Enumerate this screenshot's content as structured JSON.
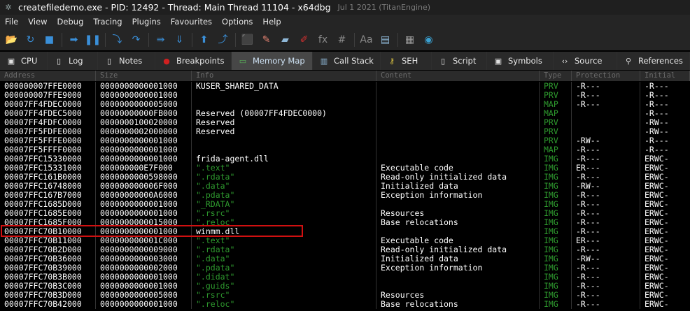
{
  "window": {
    "title": "createfiledemo.exe - PID: 12492 - Thread: Main Thread 11104 - x64dbg",
    "subtitle": "Jul 1 2021 (TitanEngine)"
  },
  "menu": [
    "File",
    "View",
    "Debug",
    "Tracing",
    "Plugins",
    "Favourites",
    "Options",
    "Help"
  ],
  "toolbar": [
    {
      "name": "open-icon",
      "glyph": "📂",
      "color": "#e8b64a"
    },
    {
      "name": "restart-icon",
      "glyph": "↻",
      "color": "#3a8fd8"
    },
    {
      "name": "stop-icon",
      "glyph": "■",
      "color": "#3a8fd8"
    },
    {
      "sep": true
    },
    {
      "name": "run-icon",
      "glyph": "➡",
      "color": "#3a8fd8"
    },
    {
      "name": "pause-icon",
      "glyph": "❚❚",
      "color": "#3a8fd8"
    },
    {
      "sep": true
    },
    {
      "name": "step-into-icon",
      "glyph": "⤵",
      "color": "#3a8fd8"
    },
    {
      "name": "step-over-icon",
      "glyph": "↷",
      "color": "#3a8fd8"
    },
    {
      "sep": true
    },
    {
      "name": "trace-into-icon",
      "glyph": "⇛",
      "color": "#3a8fd8"
    },
    {
      "name": "trace-over-icon",
      "glyph": "⇓",
      "color": "#3a8fd8"
    },
    {
      "sep": true
    },
    {
      "name": "execute-till-return-icon",
      "glyph": "⬆",
      "color": "#3a8fd8"
    },
    {
      "name": "run-to-user-code-icon",
      "glyph": "⤴",
      "color": "#3a8fd8"
    },
    {
      "sep": true
    },
    {
      "name": "scylla-icon",
      "glyph": "⬛",
      "color": "#b03030"
    },
    {
      "name": "patch-icon",
      "glyph": "✎",
      "color": "#e08070"
    },
    {
      "name": "comment-icon",
      "glyph": "▰",
      "color": "#8fb8d8"
    },
    {
      "name": "label-icon",
      "glyph": "✐",
      "color": "#d03030"
    },
    {
      "name": "function-icon",
      "glyph": "fx",
      "color": "#8a8a8a"
    },
    {
      "name": "hash-icon",
      "glyph": "#",
      "color": "#8a8a8a"
    },
    {
      "sep": true
    },
    {
      "name": "font-icon",
      "glyph": "Aa",
      "color": "#8a8a8a"
    },
    {
      "name": "strings-icon",
      "glyph": "▤",
      "color": "#8fb8d8"
    },
    {
      "sep": true
    },
    {
      "name": "calculator-icon",
      "glyph": "▦",
      "color": "#9a9a9a"
    },
    {
      "name": "globe-icon",
      "glyph": "◉",
      "color": "#3aa0d0"
    }
  ],
  "tabs": [
    {
      "name": "tab-cpu",
      "label": "CPU",
      "icon": "cpu-icon",
      "glyph": "▣",
      "color": "#e0e0e0",
      "width": 68
    },
    {
      "name": "tab-log",
      "label": "Log",
      "icon": "log-icon",
      "glyph": "▯",
      "color": "#e8e8e8",
      "width": 72
    },
    {
      "name": "tab-notes",
      "label": "Notes",
      "icon": "notes-icon",
      "glyph": "▯",
      "color": "#e8e8e8",
      "width": 82
    },
    {
      "name": "tab-breakpoints",
      "label": "Breakpoints",
      "icon": "breakpoint-icon",
      "glyph": "●",
      "color": "#d02020",
      "width": 109
    },
    {
      "name": "tab-memory-map",
      "label": "Memory Map",
      "icon": "memory-icon",
      "glyph": "▭",
      "color": "#5ab05a",
      "width": 116,
      "active": true
    },
    {
      "name": "tab-call-stack",
      "label": "Call Stack",
      "icon": "call-stack-icon",
      "glyph": "▥",
      "color": "#8fb8d8",
      "width": 97
    },
    {
      "name": "tab-seh",
      "label": "SEH",
      "icon": "seh-icon",
      "glyph": "⚷",
      "color": "#d8c040",
      "width": 73
    },
    {
      "name": "tab-script",
      "label": "Script",
      "icon": "script-icon",
      "glyph": "▯",
      "color": "#e8e8e8",
      "width": 79
    },
    {
      "name": "tab-symbols",
      "label": "Symbols",
      "icon": "symbols-icon",
      "glyph": "▣",
      "color": "#e0e0e0",
      "width": 95
    },
    {
      "name": "tab-source",
      "label": "Source",
      "icon": "source-icon",
      "glyph": "‹›",
      "color": "#e0e0e0",
      "width": 91
    },
    {
      "name": "tab-references",
      "label": "References",
      "icon": "references-icon",
      "glyph": "⚲",
      "color": "#e0e0e0",
      "width": 104
    }
  ],
  "columns": [
    "Address",
    "Size",
    "Info",
    "Content",
    "Type",
    "Protection",
    "Initial"
  ],
  "rows": [
    [
      "000000007FFE0000",
      "0000000000001000",
      "KUSER_SHARED_DATA",
      "",
      "PRV",
      "-R---",
      "-R---"
    ],
    [
      "000000007FFE9000",
      "0000000000001000",
      "",
      "",
      "PRV",
      "-R---",
      "-R---"
    ],
    [
      "00007FF4FDEC0000",
      "0000000000005000",
      "",
      "",
      "MAP",
      "-R---",
      "-R---"
    ],
    [
      "00007FF4FDEC5000",
      "00000000000FB000",
      "Reserved (00007FF4FDEC0000)",
      "",
      "MAP",
      "",
      "-R---"
    ],
    [
      "00007FF4FDFC0000",
      "0000000100020000",
      "Reserved",
      "",
      "PRV",
      "",
      "-RW--"
    ],
    [
      "00007FF5FDFE0000",
      "0000000002000000",
      "Reserved",
      "",
      "PRV",
      "",
      "-RW--"
    ],
    [
      "00007FF5FFFE0000",
      "0000000000001000",
      "",
      "",
      "PRV",
      "-RW--",
      "-R---"
    ],
    [
      "00007FF5FFFF0000",
      "0000000000001000",
      "",
      "",
      "MAP",
      "-R---",
      "-R---"
    ],
    [
      "00007FFC15330000",
      "0000000000001000",
      "frida-agent.dll",
      "",
      "IMG",
      "-R---",
      "ERWC-"
    ],
    [
      "00007FFC15331000",
      "000000000E7F000",
      "\".text\"",
      "Executable code",
      "IMG",
      "ER---",
      "ERWC-"
    ],
    [
      "00007FFC161B0000",
      "0000000000598000",
      "\".rdata\"",
      "Read-only initialized data",
      "IMG",
      "-R---",
      "ERWC-"
    ],
    [
      "00007FFC16748000",
      "000000000006F000",
      "\".data\"",
      "Initialized data",
      "IMG",
      "-RW--",
      "ERWC-"
    ],
    [
      "00007FFC167B7000",
      "00000000000A6000",
      "\".pdata\"",
      "Exception information",
      "IMG",
      "-R---",
      "ERWC-"
    ],
    [
      "00007FFC1685D000",
      "0000000000001000",
      "\"_RDATA\"",
      "",
      "IMG",
      "-R---",
      "ERWC-"
    ],
    [
      "00007FFC1685E000",
      "0000000000001000",
      "\".rsrc\"",
      "Resources",
      "IMG",
      "-R---",
      "ERWC-"
    ],
    [
      "00007FFC1685F000",
      "0000000000015000",
      "\".reloc\"",
      "Base relocations",
      "IMG",
      "-R---",
      "ERWC-"
    ],
    [
      "00007FFC70B10000",
      "0000000000001000",
      "winmm.dll",
      "",
      "IMG",
      "-R---",
      "ERWC-"
    ],
    [
      "00007FFC70B11000",
      "000000000001C000",
      "\".text\"",
      "Executable code",
      "IMG",
      "ER---",
      "ERWC-"
    ],
    [
      "00007FFC70B2D000",
      "0000000000009000",
      "\".rdata\"",
      "Read-only initialized data",
      "IMG",
      "-R---",
      "ERWC-"
    ],
    [
      "00007FFC70B36000",
      "0000000000003000",
      "\".data\"",
      "Initialized data",
      "IMG",
      "-RW--",
      "ERWC-"
    ],
    [
      "00007FFC70B39000",
      "0000000000002000",
      "\".pdata\"",
      "Exception information",
      "IMG",
      "-R---",
      "ERWC-"
    ],
    [
      "00007FFC70B3B000",
      "0000000000001000",
      "\".didat\"",
      "",
      "IMG",
      "-R---",
      "ERWC-"
    ],
    [
      "00007FFC70B3C000",
      "0000000000001000",
      "\".guids\"",
      "",
      "IMG",
      "-R---",
      "ERWC-"
    ],
    [
      "00007FFC70B3D000",
      "0000000000005000",
      "\".rsrc\"",
      "Resources",
      "IMG",
      "-R---",
      "ERWC-"
    ],
    [
      "00007FFC70B42000",
      "0000000000001000",
      "\".reloc\"",
      "Base relocations",
      "IMG",
      "-R---",
      "ERWC-"
    ]
  ],
  "colors": {
    "section_text": "#2e9a2e",
    "type_text": "#2e9a2e",
    "highlight_border": "#d01010",
    "active_tab": "#474747"
  }
}
